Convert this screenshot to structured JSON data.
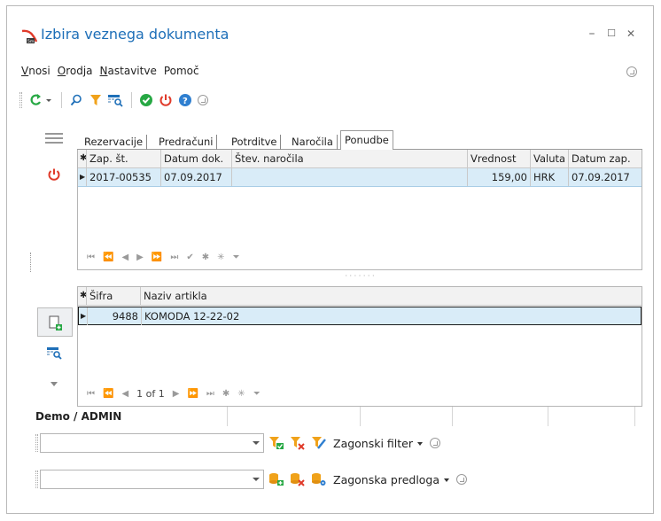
{
  "window": {
    "title": "Izbira veznega dokumenta",
    "minimize": "–",
    "maximize": "☐",
    "close": "✕"
  },
  "menu": {
    "items": [
      {
        "ul": "V",
        "rest": "nosi"
      },
      {
        "ul": "O",
        "rest": "rodja"
      },
      {
        "ul": "N",
        "rest": "astavitve"
      },
      {
        "ul": "",
        "rest": "Pomoč"
      }
    ]
  },
  "tabs": [
    "Rezervacije",
    "Predračuni",
    "Potrditve",
    "Naročila",
    "Ponudbe"
  ],
  "top_grid": {
    "headers": [
      "Zap. št.",
      "Datum dok.",
      "Štev. naročila",
      "Vrednost",
      "Valuta",
      "Datum zap."
    ],
    "rows": [
      {
        "zap_st": "2017-00535",
        "datum_dok": "07.09.2017",
        "stev_narocila": "",
        "vrednost": "159,00",
        "valuta": "HRK",
        "datum_zap": "07.09.2017"
      }
    ],
    "nav_icons": [
      "⏮",
      "⏪",
      "◀",
      "▶",
      "⏩",
      "⏭",
      "✔",
      "✱",
      "✳",
      "⏷"
    ]
  },
  "bottom_grid": {
    "headers": [
      "Šifra",
      "Naziv artikla"
    ],
    "rows": [
      {
        "sifra": "9488",
        "naziv": "KOMODA 12-22-02"
      }
    ],
    "page_info": "1 of 1"
  },
  "status": {
    "user": "Demo / ADMIN"
  },
  "filters": {
    "filter_label": "Zagonski filter",
    "template_label": "Zagonska predloga",
    "filter_value": "",
    "template_value": ""
  },
  "colors": {
    "title": "#1e6fb8",
    "row_selected": "#d9ecf8",
    "red": "#e03a2a",
    "green": "#27a844",
    "blue": "#1e6fb8",
    "orange": "#f0a21a"
  }
}
